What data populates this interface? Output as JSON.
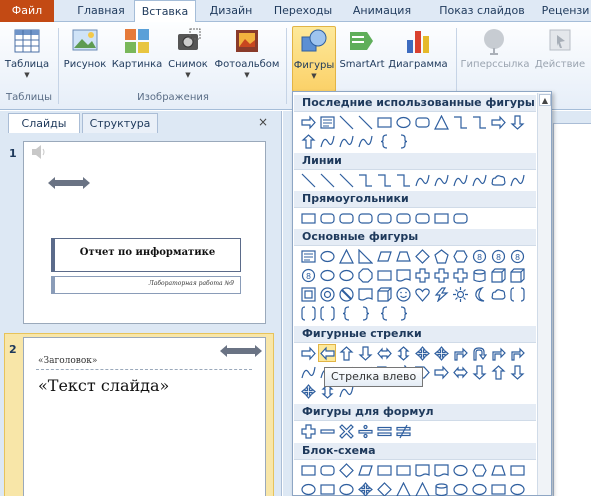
{
  "tabs": {
    "file": "Файл",
    "home": "Главная",
    "insert": "Вставка",
    "design": "Дизайн",
    "transitions": "Переходы",
    "animation": "Анимация",
    "slideshow": "Показ слайдов",
    "review": "Рецензи"
  },
  "ribbon": {
    "table": "Таблица",
    "picture": "Рисунок",
    "clipart": "Картинка",
    "screenshot": "Снимок",
    "album": "Фотоальбом",
    "shapes": "Фигуры",
    "smartart": "SmartArt",
    "chart": "Диаграмма",
    "hyperlink": "Гиперссылка",
    "action": "Действие",
    "group_tables": "Таблицы",
    "group_images": "Изображения"
  },
  "pane": {
    "tab_slides": "Слайды",
    "tab_outline": "Структура",
    "close": "×"
  },
  "slides": {
    "s1_num": "1",
    "s1_title": "Отчет по информатике",
    "s1_sub": "Лабораторная работа №9",
    "s2_num": "2",
    "s2_heading": "«Заголовок»",
    "s2_text": "«Текст слайда»"
  },
  "gallery": {
    "recent": "Последние использованные фигуры",
    "lines": "Линии",
    "rects": "Прямоугольники",
    "basic": "Основные фигуры",
    "arrows": "Фигурные стрелки",
    "equation": "Фигуры для формул",
    "flowchart": "Блок-схема"
  },
  "tooltip": "Стрелка влево",
  "colors": {
    "file_tab": "#c34a14",
    "ribbon_bg": "#dfe9f5",
    "highlight": "#fde99b"
  }
}
